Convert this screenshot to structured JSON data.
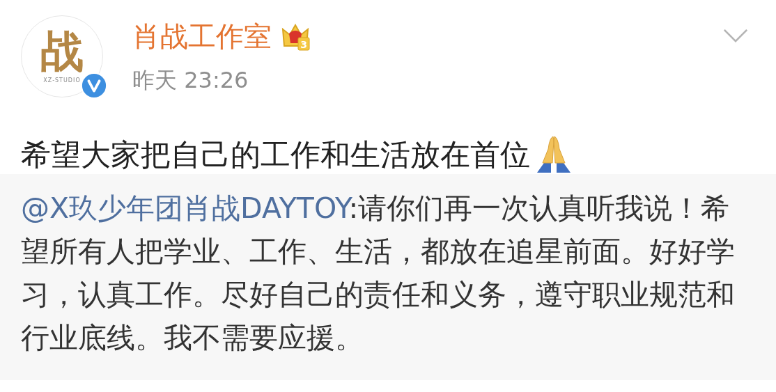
{
  "post": {
    "avatar": {
      "logo": "战",
      "caption": "XZ-STUDIO",
      "verified": true
    },
    "author": {
      "name": "肖战工作室",
      "crown_level": "3"
    },
    "time": "昨天 23:26",
    "text": "希望大家把自己的工作和生活放在首位"
  },
  "repost": {
    "mention": "@X玖少年团肖战DAYTOY",
    "text": ":请你们再一次认真听我说！希望所有人把学业、工作、生活，都放在追星前面。好好学习，认真工作。尽好自己的责任和义务，遵守职业规范和行业底线。我不需要应援。"
  }
}
